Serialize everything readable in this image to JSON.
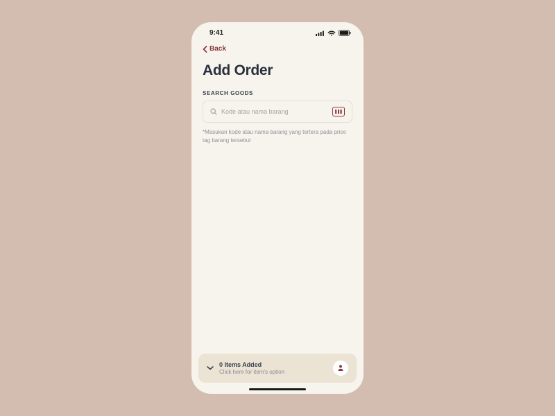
{
  "status": {
    "time": "9:41"
  },
  "nav": {
    "back_label": "Back"
  },
  "page": {
    "title": "Add Order",
    "search_section_label": "SEARCH GOODS",
    "search_placeholder": "Kode atau nama barang",
    "helper_text": "*Masukan kode atau nama barang yang tertera pada price tag barang tersebut"
  },
  "footer": {
    "items_added_title": "0 Items Added",
    "items_added_sub": "Click here for item's option"
  }
}
